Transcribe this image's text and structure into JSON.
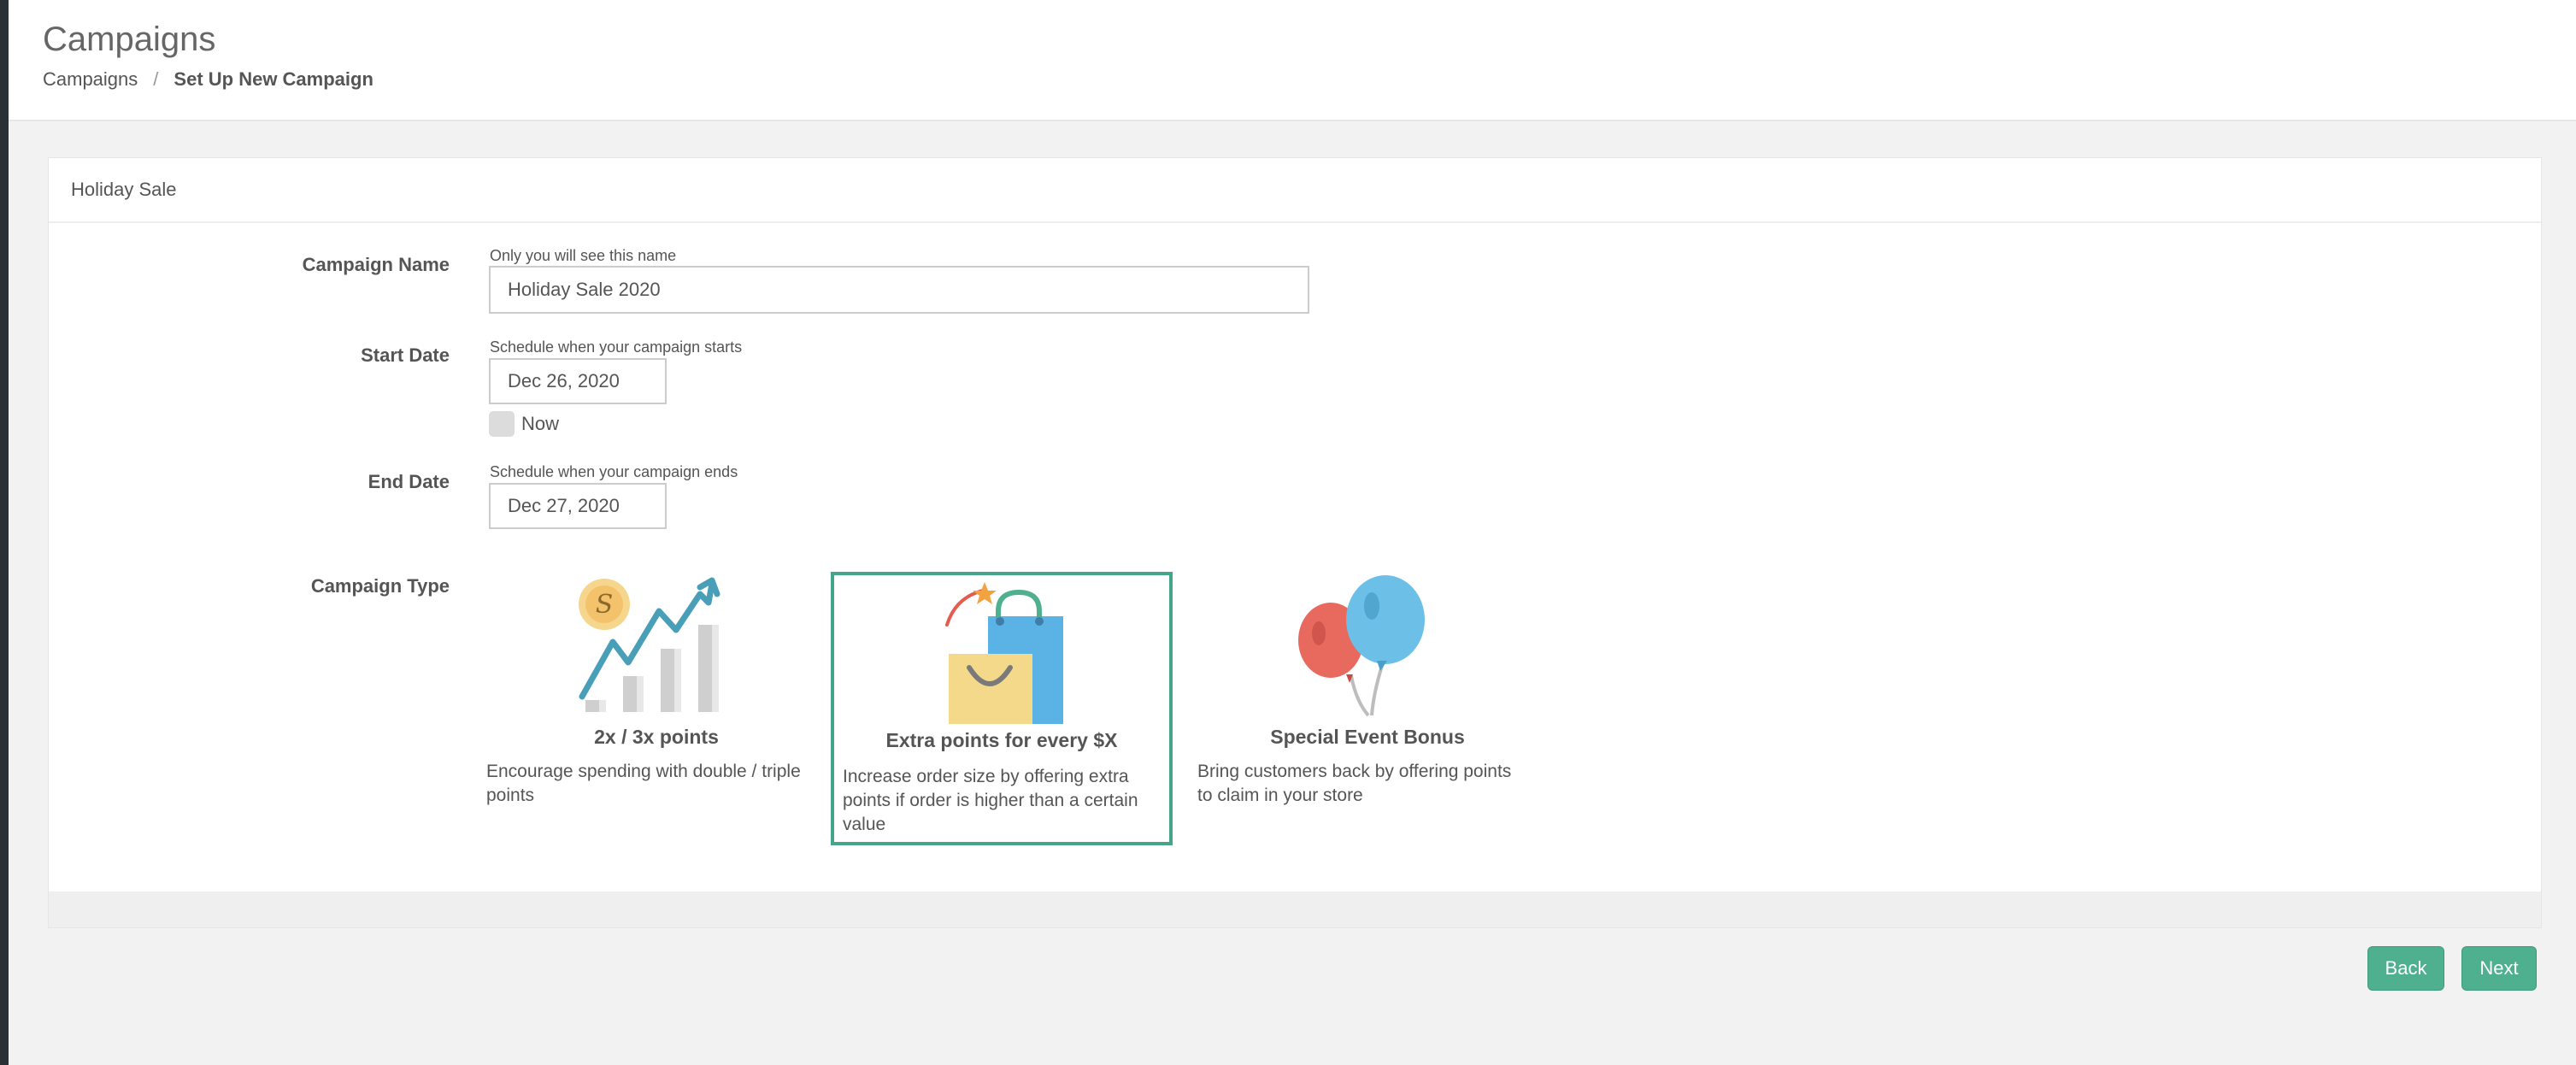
{
  "header": {
    "title": "Campaigns",
    "breadcrumb": {
      "root": "Campaigns",
      "separator": "/",
      "current": "Set Up New Campaign"
    }
  },
  "card": {
    "title": "Holiday Sale",
    "campaign_name": {
      "label": "Campaign Name",
      "hint": "Only you will see this name",
      "value": "Holiday Sale 2020"
    },
    "start_date": {
      "label": "Start Date",
      "hint": "Schedule when your campaign starts",
      "value": "Dec 26, 2020",
      "now_label": "Now",
      "now_checked": false
    },
    "end_date": {
      "label": "End Date",
      "hint": "Schedule when your campaign ends",
      "value": "Dec 27, 2020"
    },
    "campaign_type": {
      "label": "Campaign Type",
      "options": [
        {
          "title": "2x / 3x points",
          "description": "Encourage spending with double / triple points",
          "icon": "bar-chart-growth-icon",
          "selected": false
        },
        {
          "title": "Extra points for every $X",
          "description": "Increase order size by offering extra points if order is higher than a certain value",
          "icon": "shopping-bag-icon",
          "selected": true
        },
        {
          "title": "Special Event Bonus",
          "description": "Bring customers back by offering points to claim in your store",
          "icon": "balloons-icon",
          "selected": false
        }
      ]
    }
  },
  "actions": {
    "back_label": "Back",
    "next_label": "Next"
  },
  "colors": {
    "accent": "#4fb08f",
    "selected_border": "#44a58a",
    "background": "#f2f2f2"
  }
}
